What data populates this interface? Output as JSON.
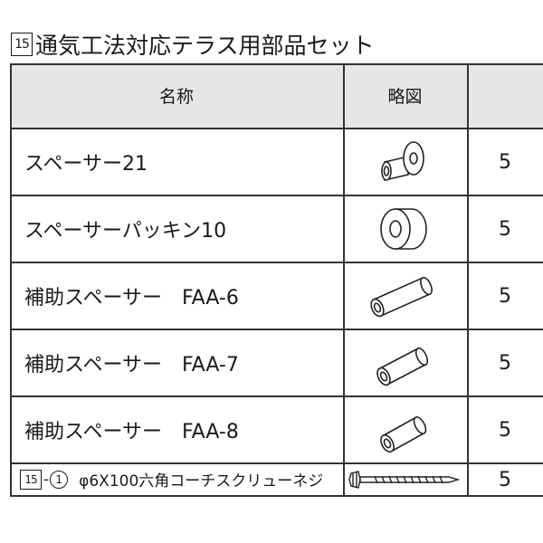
{
  "title": {
    "number": "15",
    "text": "通気工法対応テラス用部品セット"
  },
  "header": {
    "name": "名称",
    "figure": "略図",
    "qty": ""
  },
  "rows": [
    {
      "name": "スペーサー21",
      "qty": "5",
      "figure_icon": "flanged-spacer-icon"
    },
    {
      "name": "スペーサーパッキン10",
      "qty": "5",
      "figure_icon": "ring-packing-icon"
    },
    {
      "name": "補助スペーサー　FAA-6",
      "qty": "5",
      "figure_icon": "long-tube-spacer-icon"
    },
    {
      "name": "補助スペーサー　FAA-7",
      "qty": "5",
      "figure_icon": "medium-tube-spacer-icon"
    },
    {
      "name": "補助スペーサー　FAA-8",
      "qty": "5",
      "figure_icon": "short-tube-spacer-icon"
    }
  ],
  "last_row": {
    "number_box": "15",
    "dash": "-",
    "circled": "1",
    "name": "φ6X100六角コーチスクリューネジ",
    "qty": "5",
    "figure_icon": "hex-coach-screw-icon"
  }
}
